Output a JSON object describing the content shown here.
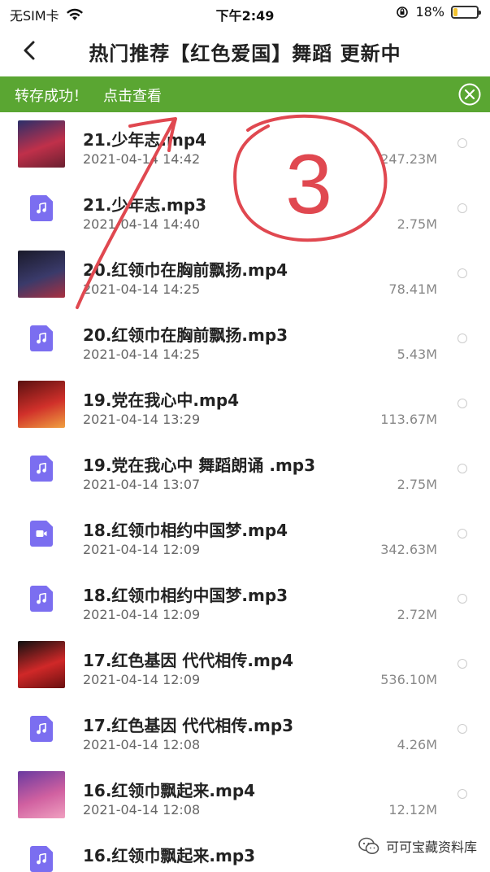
{
  "status": {
    "carrier": "无SIM卡",
    "time": "下午2:49",
    "battery_pct": "18%",
    "battery_level": 0.18,
    "battery_color": "#f4c430"
  },
  "nav": {
    "back_icon": "chevron-left-icon",
    "title": "热门推荐【红色爱国】舞蹈 更新中"
  },
  "toast": {
    "message": "转存成功！",
    "link": "点击查看",
    "close_icon": "close-circle-icon",
    "bg": "#5aa632"
  },
  "annotation": {
    "number": "3",
    "color": "#e04850"
  },
  "files": [
    {
      "name": "21.少年志.mp4",
      "date": "2021-04-14 14:42",
      "size": "247.23M",
      "kind": "video-thumb"
    },
    {
      "name": "21.少年志.mp3",
      "date": "2021-04-14 14:40",
      "size": "2.75M",
      "kind": "audio"
    },
    {
      "name": "20.红领巾在胸前飘扬.mp4",
      "date": "2021-04-14 14:25",
      "size": "78.41M",
      "kind": "video-thumb"
    },
    {
      "name": "20.红领巾在胸前飘扬.mp3",
      "date": "2021-04-14 14:25",
      "size": "5.43M",
      "kind": "audio"
    },
    {
      "name": "19.党在我心中.mp4",
      "date": "2021-04-14 13:29",
      "size": "113.67M",
      "kind": "video-thumb"
    },
    {
      "name": "19.党在我心中 舞蹈朗诵 .mp3",
      "date": "2021-04-14 13:07",
      "size": "2.75M",
      "kind": "audio"
    },
    {
      "name": "18.红领巾相约中国梦.mp4",
      "date": "2021-04-14 12:09",
      "size": "342.63M",
      "kind": "video"
    },
    {
      "name": "18.红领巾相约中国梦.mp3",
      "date": "2021-04-14 12:09",
      "size": "2.72M",
      "kind": "audio"
    },
    {
      "name": "17.红色基因 代代相传.mp4",
      "date": "2021-04-14 12:09",
      "size": "536.10M",
      "kind": "video-thumb"
    },
    {
      "name": "17.红色基因 代代相传.mp3",
      "date": "2021-04-14 12:08",
      "size": "4.26M",
      "kind": "audio"
    },
    {
      "name": "16.红领巾飘起来.mp4",
      "date": "2021-04-14 12:08",
      "size": "12.12M",
      "kind": "video-thumb"
    },
    {
      "name": "16.红领巾飘起来.mp3",
      "date": "",
      "size": "",
      "kind": "audio"
    }
  ],
  "watermark": {
    "text": "可可宝藏资料库",
    "icon": "wechat-icon"
  }
}
